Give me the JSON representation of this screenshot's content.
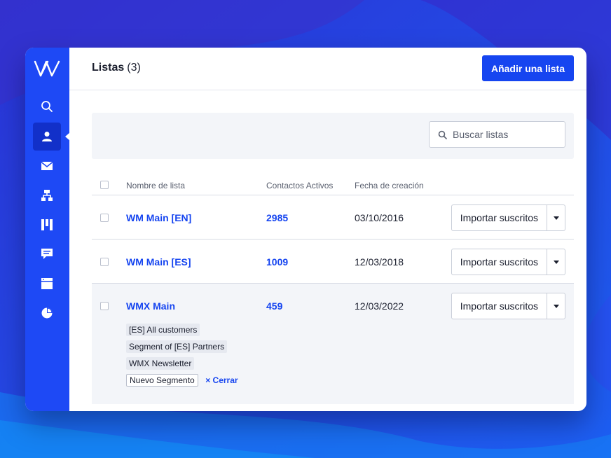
{
  "header": {
    "title": "Listas",
    "count": "(3)",
    "add_button": "Añadir una lista"
  },
  "search": {
    "placeholder": "Buscar listas",
    "value": ""
  },
  "sidebar": {
    "items": [
      {
        "icon": "search-icon",
        "active": false
      },
      {
        "icon": "contacts-icon",
        "active": true
      },
      {
        "icon": "mail-icon",
        "active": false
      },
      {
        "icon": "sitemap-icon",
        "active": false
      },
      {
        "icon": "kanban-icon",
        "active": false
      },
      {
        "icon": "chat-icon",
        "active": false
      },
      {
        "icon": "browser-icon",
        "active": false
      },
      {
        "icon": "pie-chart-icon",
        "active": false
      }
    ]
  },
  "table": {
    "columns": [
      "Nombre de lista",
      "Contactos Activos",
      "Fecha de creación"
    ],
    "rows": [
      {
        "name": "WM Main [EN]",
        "contacts": "2985",
        "date": "03/10/2016",
        "action": "Importar suscritos"
      },
      {
        "name": "WM Main [ES]",
        "contacts": "1009",
        "date": "12/03/2018",
        "action": "Importar suscritos"
      },
      {
        "name": "WMX Main",
        "contacts": "459",
        "date": "12/03/2022",
        "action": "Importar suscritos"
      }
    ],
    "segments": [
      "[ES] All customers",
      "Segment of [ES] Partners",
      "WMX Newsletter"
    ],
    "new_segment": "Nuevo Segmento",
    "close_label": "× Cerrar"
  },
  "colors": {
    "accent": "#1645f0",
    "sidebar": "#1e49f5",
    "sidebar_active": "#1230c9"
  }
}
